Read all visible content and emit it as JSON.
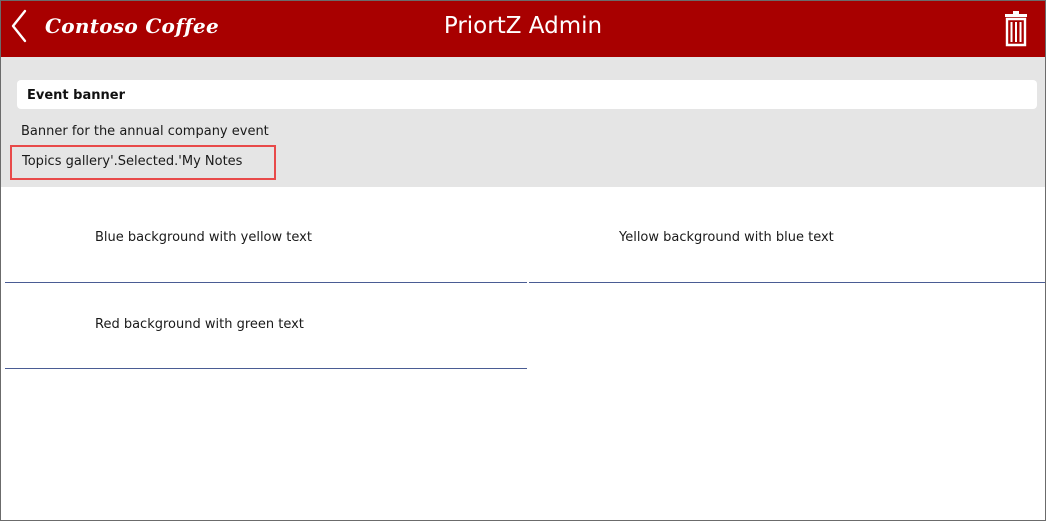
{
  "header": {
    "logo_text": "Contoso Coffee",
    "title": "PriortZ Admin",
    "back_icon": "chevron-left-icon",
    "delete_icon": "trash-icon",
    "background_color": "#a80000",
    "text_color": "#ffffff"
  },
  "form": {
    "title_value": "Event banner",
    "description": "Banner for the annual company event",
    "notes_formula": "Topics gallery'.Selected.'My Notes",
    "panel_color": "#e5e5e5",
    "highlight_color": "#e84a4a"
  },
  "gallery": {
    "items": [
      {
        "label": "Blue background with yellow text"
      },
      {
        "label": "Yellow background with blue text"
      },
      {
        "label": "Red background with green text"
      }
    ],
    "divider_color": "#4a5c94"
  }
}
